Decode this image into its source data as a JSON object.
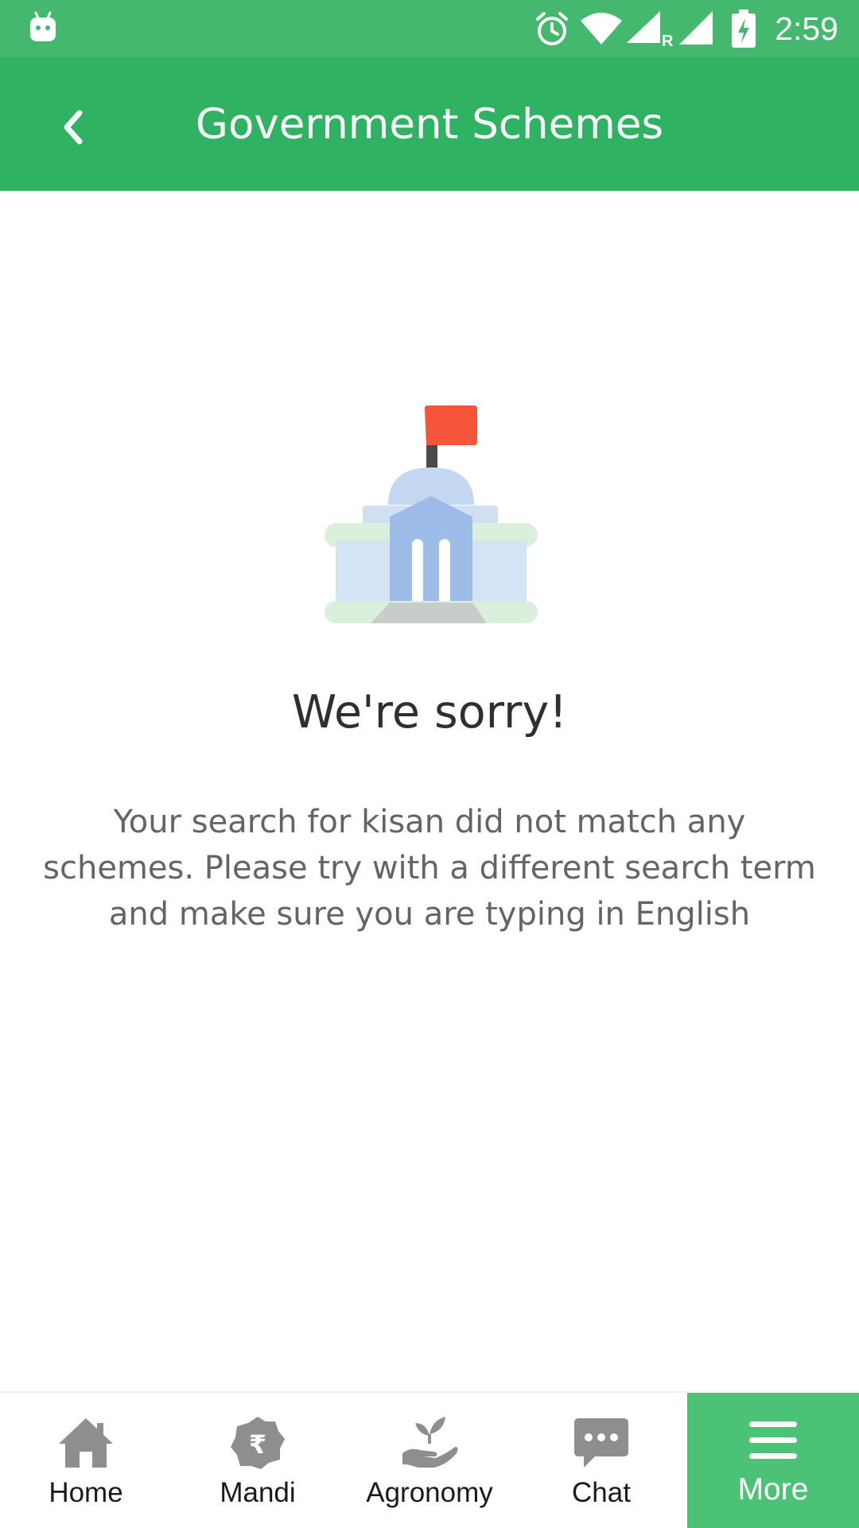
{
  "status_bar": {
    "time": "2:59",
    "icons": [
      "android-icon",
      "alarm-icon",
      "wifi-icon",
      "signal-roaming-icon",
      "signal-icon",
      "battery-charging-icon"
    ],
    "roaming_indicator": "R"
  },
  "app_bar": {
    "title": "Government Schemes",
    "back_icon": "chevron-left-icon"
  },
  "empty_state": {
    "illustration": "government-building-icon",
    "title": "We're sorry!",
    "message": "Your search for kisan did not match any schemes. Please try with a different search term and make sure you are typing in English"
  },
  "bottom_nav": {
    "items": [
      {
        "label": "Home",
        "icon": "home-icon",
        "active": false
      },
      {
        "label": "Mandi",
        "icon": "rupee-icon",
        "active": false
      },
      {
        "label": "Agronomy",
        "icon": "plant-hand-icon",
        "active": false
      },
      {
        "label": "Chat",
        "icon": "chat-icon",
        "active": false
      },
      {
        "label": "More",
        "icon": "menu-icon",
        "active": true
      }
    ]
  },
  "colors": {
    "status_bar": "#43b86e",
    "app_bar": "#2fb262",
    "active_nav": "#4cc277",
    "flag": "#f7553a"
  }
}
